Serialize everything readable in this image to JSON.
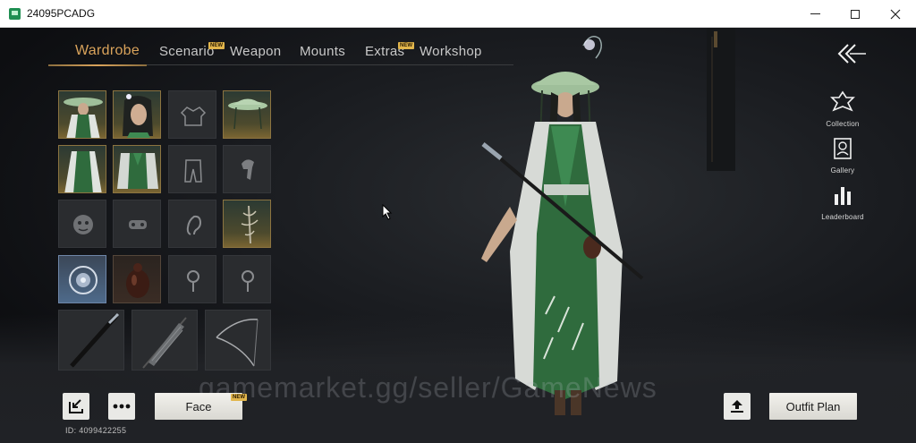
{
  "window": {
    "title": "24095PCADG"
  },
  "tabs": [
    {
      "label": "Wardrobe",
      "active": true,
      "new": false
    },
    {
      "label": "Scenario",
      "active": false,
      "new": true
    },
    {
      "label": "Weapon",
      "active": false,
      "new": false
    },
    {
      "label": "Mounts",
      "active": false,
      "new": false
    },
    {
      "label": "Extras",
      "active": false,
      "new": true
    },
    {
      "label": "Workshop",
      "active": false,
      "new": false
    }
  ],
  "new_badge": "NEW",
  "wardrobe": {
    "slots": [
      {
        "name": "outfit",
        "icon": "full-outfit-portrait",
        "filled": true
      },
      {
        "name": "hairstyle",
        "icon": "hairstyle-portrait",
        "filled": true
      },
      {
        "name": "top",
        "icon": "jacket-icon",
        "filled": false
      },
      {
        "name": "headwear",
        "icon": "bamboo-hat-icon",
        "filled": true
      },
      {
        "name": "robe",
        "icon": "robe-icon",
        "filled": true
      },
      {
        "name": "pants",
        "icon": "pants-icon",
        "filled": false
      },
      {
        "name": "hair-accessory",
        "icon": "hair-accessory-icon",
        "filled": false
      },
      {
        "name": "mask",
        "icon": "mask-icon",
        "filled": false
      },
      {
        "name": "face-accessory",
        "icon": "face-accessory-icon",
        "filled": false
      },
      {
        "name": "earring",
        "icon": "ear-icon",
        "filled": false
      },
      {
        "name": "back-ornament",
        "icon": "back-ornament-icon",
        "filled": true
      },
      {
        "name": "pendant",
        "icon": "pendant-icon",
        "filled": true
      },
      {
        "name": "gourd",
        "icon": "gourd-icon",
        "filled": true
      },
      {
        "name": "ring-1",
        "icon": "ring-icon",
        "filled": false
      },
      {
        "name": "ring-2",
        "icon": "ring-icon",
        "filled": false
      },
      {
        "name": "sword",
        "icon": "sword-icon",
        "filled": false
      },
      {
        "name": "umbrella",
        "icon": "umbrella-icon",
        "filled": false
      },
      {
        "name": "bow",
        "icon": "bow-icon",
        "filled": false
      }
    ]
  },
  "right_rail": [
    {
      "label": "Collection",
      "icon": "collection-icon"
    },
    {
      "label": "Gallery",
      "icon": "gallery-icon"
    },
    {
      "label": "Leaderboard",
      "icon": "leaderboard-icon"
    }
  ],
  "bottom": {
    "face_label": "Face",
    "outfit_plan_label": "Outfit Plan",
    "id_text": "ID: 4099422255",
    "export_icon": "export-icon",
    "more_icon": "more-icon",
    "upload_icon": "upload-icon"
  },
  "watermark": "gamemarket.gg/seller/GameNews",
  "colors": {
    "accent": "#d9a35b",
    "badge": "#e2b64c"
  }
}
